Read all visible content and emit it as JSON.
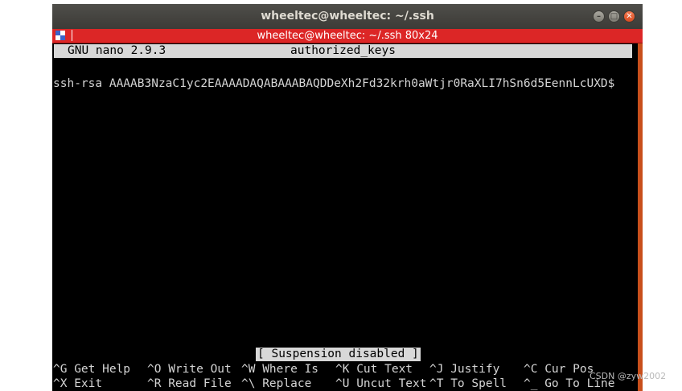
{
  "window": {
    "title": "wheeltec@wheeltec: ~/.ssh",
    "tab_title": "wheeltec@wheeltec: ~/.ssh 80x24",
    "minimize_glyph": "–",
    "maximize_glyph": "□",
    "close_glyph": "✕"
  },
  "nano": {
    "version": "GNU nano 2.9.3",
    "filename": "authorized_keys",
    "content_line": "ssh-rsa AAAAB3NzaC1yc2EAAAADAQABAAABAQDDeXh2Fd32krh0aWtjr0RaXLI7hSn6d5EennLcUXD$",
    "status_message": "[ Suspension disabled ]",
    "shortcuts_row1": [
      {
        "key": "^G",
        "label": "Get Help"
      },
      {
        "key": "^O",
        "label": "Write Out"
      },
      {
        "key": "^W",
        "label": "Where Is"
      },
      {
        "key": "^K",
        "label": "Cut Text"
      },
      {
        "key": "^J",
        "label": "Justify"
      },
      {
        "key": "^C",
        "label": "Cur Pos"
      }
    ],
    "shortcuts_row2": [
      {
        "key": "^X",
        "label": "Exit"
      },
      {
        "key": "^R",
        "label": "Read File"
      },
      {
        "key": "^\\",
        "label": "Replace"
      },
      {
        "key": "^U",
        "label": "Uncut Text"
      },
      {
        "key": "^T",
        "label": "To Spell"
      },
      {
        "key": "^_",
        "label": "Go To Line"
      }
    ]
  },
  "watermark": "CSDN @zyw2002",
  "colors": {
    "title_bar": "#3c3b37",
    "tab_bar": "#dc2626",
    "terminal_bg": "#000000",
    "terminal_fg": "#d4d4d4",
    "scrollbar": "#c84f1c"
  }
}
